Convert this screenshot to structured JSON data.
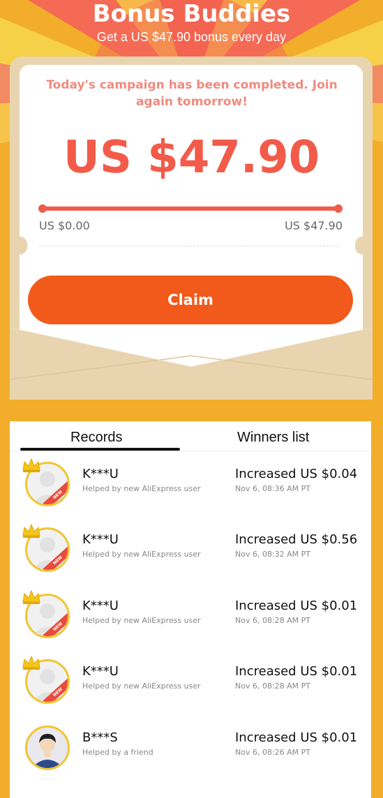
{
  "header": {
    "title": "Bonus Buddies",
    "subtitle": "Get a US $47.90 bonus every day"
  },
  "campaign": {
    "message": "Today's campaign has been completed. Join again tomorrow!",
    "amount": "US $47.90",
    "progress_fraction": 1.0,
    "range_min": "US $0.00",
    "range_max": "US $47.90",
    "claim_label": "Claim"
  },
  "tabs": {
    "records": "Records",
    "winners": "Winners list",
    "active": "records"
  },
  "records": [
    {
      "name": "K***U",
      "helped": "Helped by new AliExpress user",
      "increase": "Increased US $0.04",
      "time": "Nov 6, 08:36 AM PT",
      "badge": "NEW",
      "crown": true,
      "avatar": "placeholder"
    },
    {
      "name": "K***U",
      "helped": "Helped by new AliExpress user",
      "increase": "Increased US $0.56",
      "time": "Nov 6, 08:32 AM PT",
      "badge": "NEW",
      "crown": true,
      "avatar": "placeholder"
    },
    {
      "name": "K***U",
      "helped": "Helped by new AliExpress user",
      "increase": "Increased US $0.01",
      "time": "Nov 6, 08:28 AM PT",
      "badge": "NEW",
      "crown": true,
      "avatar": "placeholder"
    },
    {
      "name": "K***U",
      "helped": "Helped by new AliExpress user",
      "increase": "Increased US $0.01",
      "time": "Nov 6, 08:28 AM PT",
      "badge": "NEW",
      "crown": true,
      "avatar": "placeholder"
    },
    {
      "name": "B***S",
      "helped": "Helped by a friend",
      "increase": "Increased US $0.01",
      "time": "Nov 6, 08:26 AM PT",
      "badge": "",
      "crown": false,
      "avatar": "person"
    }
  ],
  "colors": {
    "page_background": "#f2ae2a",
    "accent_red": "#f25b4a",
    "claim_orange": "#f15a1b",
    "envelope": "#e8d5b0",
    "message_pink": "#f08a7e"
  },
  "icons": {
    "crown": "crown-icon",
    "avatar_placeholder": "user-placeholder-icon",
    "avatar_person": "user-avatar-icon"
  }
}
